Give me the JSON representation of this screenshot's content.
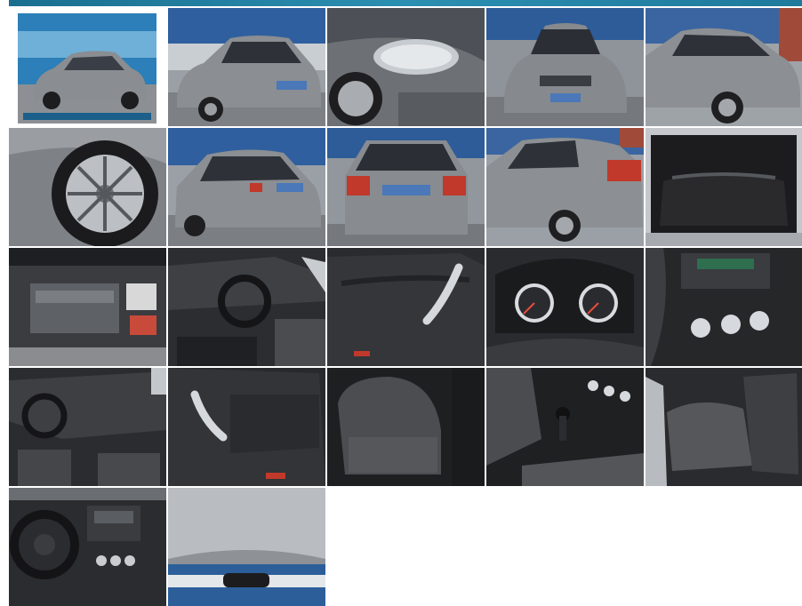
{
  "gallery": {
    "photos": [
      {
        "icon": "car-exterior-front-icon"
      },
      {
        "icon": "car-exterior-front-icon"
      },
      {
        "icon": "car-headlight-icon"
      },
      {
        "icon": "car-exterior-front-icon"
      },
      {
        "icon": "car-exterior-side-icon"
      },
      {
        "icon": "car-wheel-icon"
      },
      {
        "icon": "car-exterior-rear-icon"
      },
      {
        "icon": "car-exterior-rear-icon"
      },
      {
        "icon": "car-exterior-rear-icon"
      },
      {
        "icon": "car-trunk-icon"
      },
      {
        "icon": "car-engine-icon"
      },
      {
        "icon": "car-interior-dashboard-icon"
      },
      {
        "icon": "car-door-panel-icon"
      },
      {
        "icon": "car-instrument-cluster-icon"
      },
      {
        "icon": "car-center-console-icon"
      },
      {
        "icon": "car-interior-dashboard-icon"
      },
      {
        "icon": "car-door-panel-icon"
      },
      {
        "icon": "car-seat-icon"
      },
      {
        "icon": "car-gear-shift-icon"
      },
      {
        "icon": "car-rear-seat-icon"
      },
      {
        "icon": "car-steering-wheel-icon"
      },
      {
        "icon": "car-headliner-icon"
      }
    ]
  }
}
